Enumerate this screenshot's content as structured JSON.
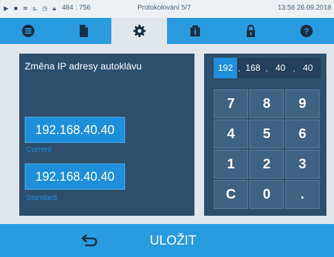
{
  "status": {
    "coords": "484 : 756",
    "title": "Protokolování 5/7",
    "time": "13:58",
    "date": "26.09.2018",
    "icons": [
      "play-icon",
      "document-icon",
      "signal-icon",
      "chart-icon",
      "clock-icon",
      "lock-icon"
    ]
  },
  "tabs": [
    {
      "name": "list",
      "icon": "list-icon"
    },
    {
      "name": "document",
      "icon": "document-icon"
    },
    {
      "name": "settings",
      "icon": "gear-icon",
      "active": true
    },
    {
      "name": "info",
      "icon": "info-icon"
    },
    {
      "name": "lock",
      "icon": "lock-icon"
    },
    {
      "name": "help",
      "icon": "help-icon"
    }
  ],
  "main": {
    "heading": "Změna IP adresy autoklávu",
    "current": {
      "value": "192.168.40.40",
      "label": "Current"
    },
    "standard": {
      "value": "192.168.40.40",
      "label": "Standard"
    }
  },
  "ip_input": {
    "octets": [
      "192",
      "168",
      "40",
      "40"
    ],
    "separators": [
      ".",
      ".",
      "."
    ],
    "selected_index": 0
  },
  "keypad": {
    "keys": [
      "7",
      "8",
      "9",
      "4",
      "5",
      "6",
      "1",
      "2",
      "3",
      "C",
      "0",
      "."
    ]
  },
  "footer": {
    "save_label": "ULOŽIT"
  },
  "colors": {
    "accent": "#2b9be0",
    "panel": "#2e4f6c",
    "button": "#1f8fdb",
    "key": "#3e6282"
  }
}
